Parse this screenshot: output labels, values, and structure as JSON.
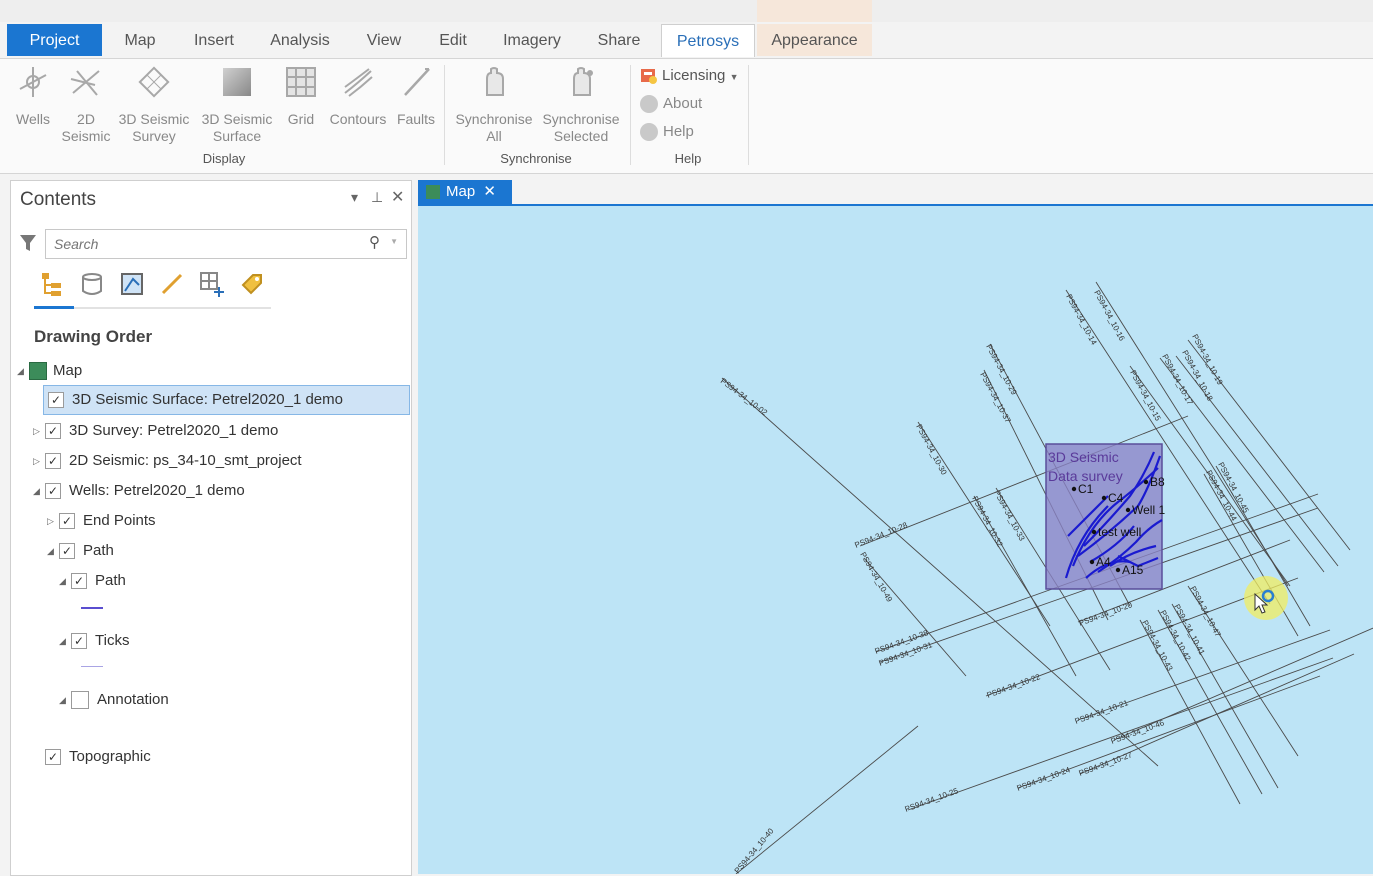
{
  "ribbon_tabs": {
    "project": "Project",
    "map": "Map",
    "insert": "Insert",
    "analysis": "Analysis",
    "view": "View",
    "edit": "Edit",
    "imagery": "Imagery",
    "share": "Share",
    "petrosys": "Petrosys",
    "appearance": "Appearance"
  },
  "ribbon": {
    "display": {
      "wells": "Wells",
      "seis2d_l1": "2D",
      "seis2d_l2": "Seismic",
      "survey3d_l1": "3D Seismic",
      "survey3d_l2": "Survey",
      "surface3d_l1": "3D Seismic",
      "surface3d_l2": "Surface",
      "grid": "Grid",
      "contours": "Contours",
      "faults": "Faults",
      "group": "Display"
    },
    "synchronise": {
      "all_l1": "Synchronise",
      "all_l2": "All",
      "sel_l1": "Synchronise",
      "sel_l2": "Selected",
      "group": "Synchronise"
    },
    "help": {
      "licensing": "Licensing",
      "about": "About",
      "help": "Help",
      "group": "Help"
    }
  },
  "contents": {
    "title": "Contents",
    "search_placeholder": "Search",
    "drawing_order": "Drawing Order",
    "items": {
      "map": "Map",
      "surface3d": "3D Seismic Surface: Petrel2020_1 demo",
      "survey3d": "3D Survey: Petrel2020_1 demo",
      "seis2d": "2D Seismic: ps_34-10_smt_project",
      "wells": "Wells: Petrel2020_1 demo",
      "end_points": "End Points",
      "path_group": "Path",
      "path": "Path",
      "ticks": "Ticks",
      "annotation": "Annotation",
      "topographic": "Topographic"
    }
  },
  "map_view": {
    "tab_label": "Map",
    "survey_label_1": "3D Seismic",
    "survey_label_2": "Data survey",
    "wells": [
      "C1",
      "C4",
      "B8",
      "Well 1",
      "test well",
      "A15",
      "A4"
    ],
    "lines": [
      "PS94-34_10-16",
      "PS94-34_10-14",
      "PS94-34_10-18",
      "PS94-34_10-19",
      "PS94-34_10-17",
      "PS94-34_10-15",
      "PS94-34_10-29",
      "PS94-34_10-37",
      "PS94-34_10-02",
      "PS94-34_10-30",
      "PS94-34_10-32",
      "PS94-34_10-33",
      "PS94-34_10-28",
      "PS94-34_10-49",
      "PS94-34_10-38",
      "PS94-34_10-31",
      "PS94-34_10-22",
      "PS94-34_10-20",
      "PS94-34_10-21",
      "PS94-34_10-24",
      "PS94-34_10-25",
      "PS94-34_10-27",
      "PS94-34_10-46",
      "PS94-34_10-43",
      "PS94-34_10-42",
      "PS94-34_10-41",
      "PS94-34_10-47",
      "PS94-34_10-44",
      "PS94-34_10-45",
      "PS94-34_10-40"
    ]
  },
  "colors": {
    "accent": "#1b76d1",
    "map_bg": "#bde4f6",
    "survey_fill": "#8a83c6",
    "well_path": "#1a1ad0",
    "selected_row": "#cfe3f6"
  }
}
